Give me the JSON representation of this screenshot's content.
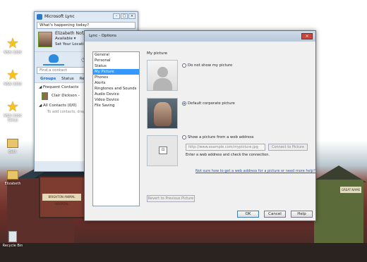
{
  "desktop": {
    "icons": [
      {
        "label": "MSN 3000",
        "kind": "star"
      },
      {
        "label": "MSN 3000",
        "kind": "star"
      },
      {
        "label": "MSN 3000 Setup",
        "kind": "star"
      },
      {
        "label": "Beth",
        "kind": "folder"
      },
      {
        "label": "Elizabeth",
        "kind": "folder"
      },
      {
        "label": "Recycle Bin",
        "kind": "bin"
      }
    ],
    "sign_left": "BRIGHTON ANIMAL HOSPITAL",
    "sign_right": "GREAT NAME"
  },
  "lync": {
    "title": "Microsoft Lync",
    "whats_happening": "What's happening today?",
    "user_name": "Elizabeth Nofz",
    "status": "Available",
    "location": "Set Your Location",
    "find_placeholder": "Find a contact",
    "tabs": [
      "Groups",
      "Status",
      "Re"
    ],
    "group_frequent": "Frequent Contacts",
    "contact_name": "Clair Dickson -",
    "group_all": "All Contacts (0/0)",
    "add_hint": "To add contacts, drag"
  },
  "options": {
    "title": "Lync - Options",
    "nav": [
      "General",
      "Personal",
      "Status",
      "My Picture",
      "Phones",
      "Alerts",
      "Ringtones and Sounds",
      "Audio Device",
      "Video Device",
      "File Saving"
    ],
    "selected_nav": "My Picture",
    "section_title": "My picture",
    "radio_no_picture": "Do not show my picture",
    "radio_default": "Default corporate picture",
    "radio_web": "Show a picture from a web address",
    "url_placeholder": "http://www.example.com/mypicture.jpg",
    "connect_label": "Connect to Picture",
    "url_hint": "Enter a web address and check the connection.",
    "help_link": "Not sure how to get a web address for a picture or need more help?",
    "revert_label": "Revert to Previous Picture",
    "ok_label": "OK",
    "cancel_label": "Cancel",
    "help_label": "Help"
  }
}
